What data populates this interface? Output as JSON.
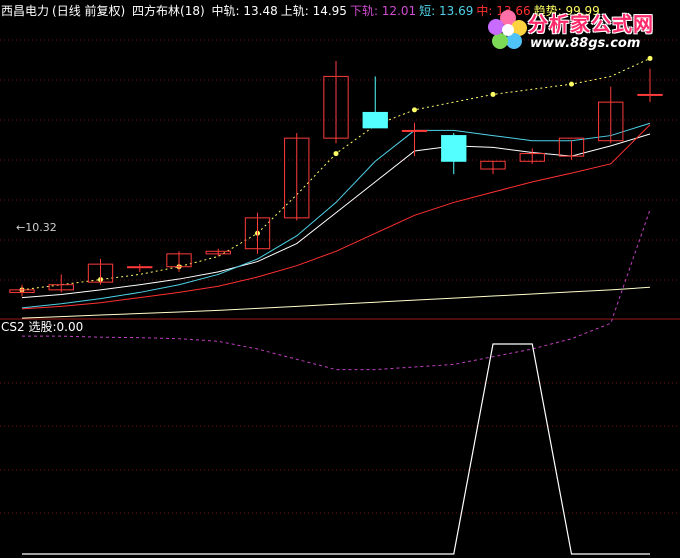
{
  "header": {
    "stock": "西昌电力",
    "period": "(日线 前复权)",
    "indicator": "四方布林(18)",
    "items": [
      {
        "label": "中轨:",
        "value": "13.48",
        "color": "#ffffff"
      },
      {
        "label": "上轨:",
        "value": "14.95",
        "color": "#ffffff"
      },
      {
        "label": "下轨:",
        "value": "12.01",
        "color": "#d04bd0"
      },
      {
        "label": "短:",
        "value": "13.69",
        "color": "#4fd3e8"
      },
      {
        "label": "中:",
        "value": "13.66",
        "color": "#ff3030"
      },
      {
        "label": "趋势:",
        "value": "99.99",
        "color": "#ffff66"
      }
    ]
  },
  "sub_header": {
    "name": "CS2",
    "label": "选股:",
    "value": "0.00"
  },
  "low_label": "←10.32",
  "logo": {
    "name": "分析家公式网",
    "url": "www.88gs.com",
    "icon": "flower-logo-icon"
  },
  "colors": {
    "background": "#000000",
    "grid": "#7a1010",
    "up_candle": "#ff3b3b",
    "down_candle": "#54ffff",
    "mid_line": "#ffffff",
    "upper_dots": "#ffff66",
    "lower_band": "#c040c0",
    "short_line": "#4fd3e8",
    "mid_red": "#ff3030",
    "long_line": "#ffffcc",
    "cs2": "#ffffff"
  },
  "chart_data": [
    {
      "type": "candlestick",
      "title": "西昌电力(日线 前复权) 四方布林(18)",
      "y_range": [
        10.0,
        15.6
      ],
      "candles": [
        {
          "o": 10.4,
          "h": 10.55,
          "l": 10.32,
          "c": 10.45
        },
        {
          "o": 10.45,
          "h": 10.75,
          "l": 10.4,
          "c": 10.55
        },
        {
          "o": 10.6,
          "h": 11.05,
          "l": 10.55,
          "c": 10.95
        },
        {
          "o": 10.9,
          "h": 10.95,
          "l": 10.8,
          "c": 10.9
        },
        {
          "o": 10.9,
          "h": 11.2,
          "l": 10.8,
          "c": 11.15
        },
        {
          "o": 11.15,
          "h": 11.25,
          "l": 11.1,
          "c": 11.2
        },
        {
          "o": 11.25,
          "h": 11.95,
          "l": 11.15,
          "c": 11.85
        },
        {
          "o": 11.85,
          "h": 13.5,
          "l": 11.8,
          "c": 13.4
        },
        {
          "o": 13.4,
          "h": 14.9,
          "l": 13.3,
          "c": 14.6
        },
        {
          "o": 13.9,
          "h": 14.6,
          "l": 13.6,
          "c": 13.6
        },
        {
          "o": 13.55,
          "h": 13.7,
          "l": 13.05,
          "c": 13.55
        },
        {
          "o": 13.45,
          "h": 13.5,
          "l": 12.7,
          "c": 12.95
        },
        {
          "o": 12.8,
          "h": 12.95,
          "l": 12.7,
          "c": 12.95
        },
        {
          "o": 12.95,
          "h": 13.2,
          "l": 12.9,
          "c": 13.1
        },
        {
          "o": 13.05,
          "h": 13.35,
          "l": 12.98,
          "c": 13.4
        },
        {
          "o": 13.35,
          "h": 14.4,
          "l": 13.3,
          "c": 14.1
        },
        {
          "o": 14.25,
          "h": 14.75,
          "l": 14.1,
          "c": 14.25
        }
      ],
      "series": [
        {
          "name": "中轨",
          "values": [
            10.3,
            10.36,
            10.45,
            10.55,
            10.66,
            10.8,
            11.0,
            11.35,
            11.95,
            12.55,
            13.15,
            13.25,
            13.22,
            13.12,
            13.05,
            13.25,
            13.48
          ]
        },
        {
          "name": "上轨",
          "values": [
            10.45,
            10.55,
            10.65,
            10.75,
            10.9,
            11.1,
            11.55,
            12.3,
            13.1,
            13.65,
            13.95,
            14.1,
            14.25,
            14.35,
            14.45,
            14.6,
            14.95
          ]
        },
        {
          "name": "下轨",
          "values": [
            9.55,
            9.55,
            9.53,
            9.52,
            9.5,
            9.45,
            9.3,
            9.1,
            8.9,
            8.9,
            8.95,
            9.0,
            9.15,
            9.3,
            9.5,
            9.8,
            12.01
          ]
        },
        {
          "name": "短",
          "values": [
            10.1,
            10.18,
            10.28,
            10.4,
            10.55,
            10.75,
            11.05,
            11.5,
            12.15,
            12.95,
            13.55,
            13.55,
            13.45,
            13.35,
            13.35,
            13.45,
            13.69
          ]
        },
        {
          "name": "中",
          "values": [
            10.08,
            10.13,
            10.2,
            10.3,
            10.4,
            10.52,
            10.7,
            10.92,
            11.2,
            11.55,
            11.9,
            12.15,
            12.35,
            12.55,
            12.72,
            12.9,
            13.66
          ]
        },
        {
          "name": "趋势",
          "values": [
            9.9,
            9.93,
            9.96,
            9.99,
            10.02,
            10.05,
            10.09,
            10.13,
            10.17,
            10.21,
            10.25,
            10.29,
            10.33,
            10.37,
            10.41,
            10.45,
            10.5
          ]
        }
      ]
    },
    {
      "type": "line",
      "title": "CS2",
      "y_range": [
        0,
        1
      ],
      "series": [
        {
          "name": "选股",
          "values": [
            0,
            0,
            0,
            0,
            0,
            0,
            0,
            0,
            0,
            0,
            0,
            0,
            1,
            1,
            0,
            0,
            0
          ]
        }
      ]
    }
  ]
}
